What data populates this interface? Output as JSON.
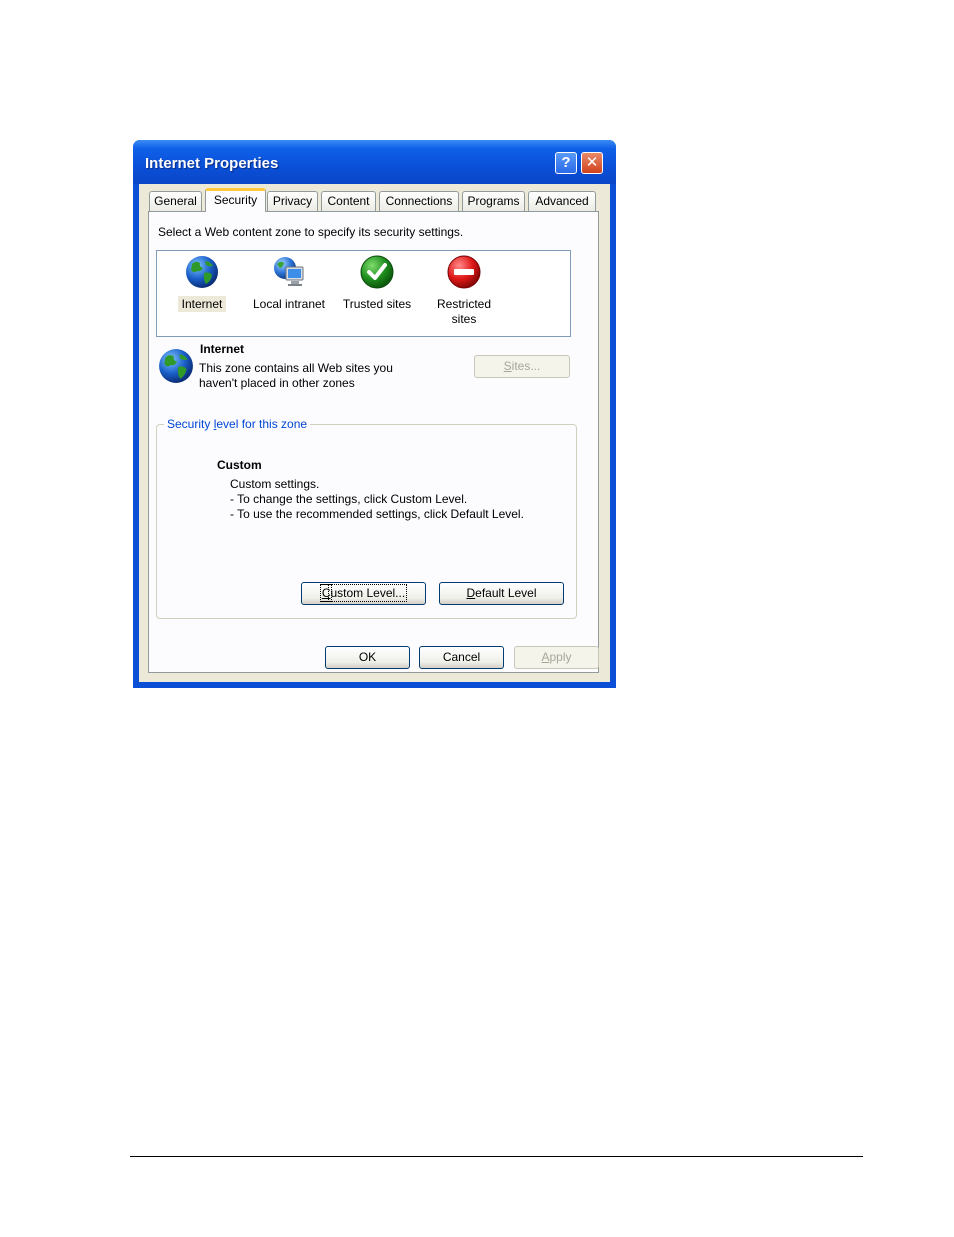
{
  "window": {
    "title": "Internet Properties",
    "help_glyph": "?",
    "close_glyph": "✕"
  },
  "tabs": [
    {
      "label": "General",
      "active": false
    },
    {
      "label": "Security",
      "active": true
    },
    {
      "label": "Privacy",
      "active": false
    },
    {
      "label": "Content",
      "active": false
    },
    {
      "label": "Connections",
      "active": false
    },
    {
      "label": "Programs",
      "active": false
    },
    {
      "label": "Advanced",
      "active": false
    }
  ],
  "security": {
    "instruction": "Select a Web content zone to specify its security settings.",
    "zones": [
      {
        "label": "Internet",
        "icon": "globe-icon",
        "selected": true
      },
      {
        "label": "Local intranet",
        "icon": "network-globe-icon",
        "selected": false
      },
      {
        "label": "Trusted sites",
        "icon": "checkmark-icon",
        "selected": false
      },
      {
        "label_line1": "Restricted",
        "label_line2": "sites",
        "icon": "no-entry-icon",
        "selected": false
      }
    ],
    "zone_title": "Internet",
    "zone_desc_line1": "This zone contains all Web sites you",
    "zone_desc_line2": "haven't placed in other zones",
    "sites_button": {
      "pre": "",
      "accel": "S",
      "post": "ites..."
    },
    "level_group": {
      "pre": "Security ",
      "accel": "l",
      "post": "evel for this zone"
    },
    "level_name": "Custom",
    "level_lines": [
      "Custom settings.",
      "- To change the settings, click Custom Level.",
      "- To use the recommended settings, click Default Level."
    ],
    "custom_level_button": {
      "accel": "C",
      "post": "ustom Level..."
    },
    "default_level_button": {
      "accel": "D",
      "post": "efault Level"
    }
  },
  "buttons": {
    "ok": "OK",
    "cancel": "Cancel",
    "apply_accel": "A",
    "apply_post": "pply"
  },
  "colors": {
    "title_bar": "#0a50d8",
    "dialog_face": "#ece9d8",
    "group_label": "#0046d5"
  }
}
